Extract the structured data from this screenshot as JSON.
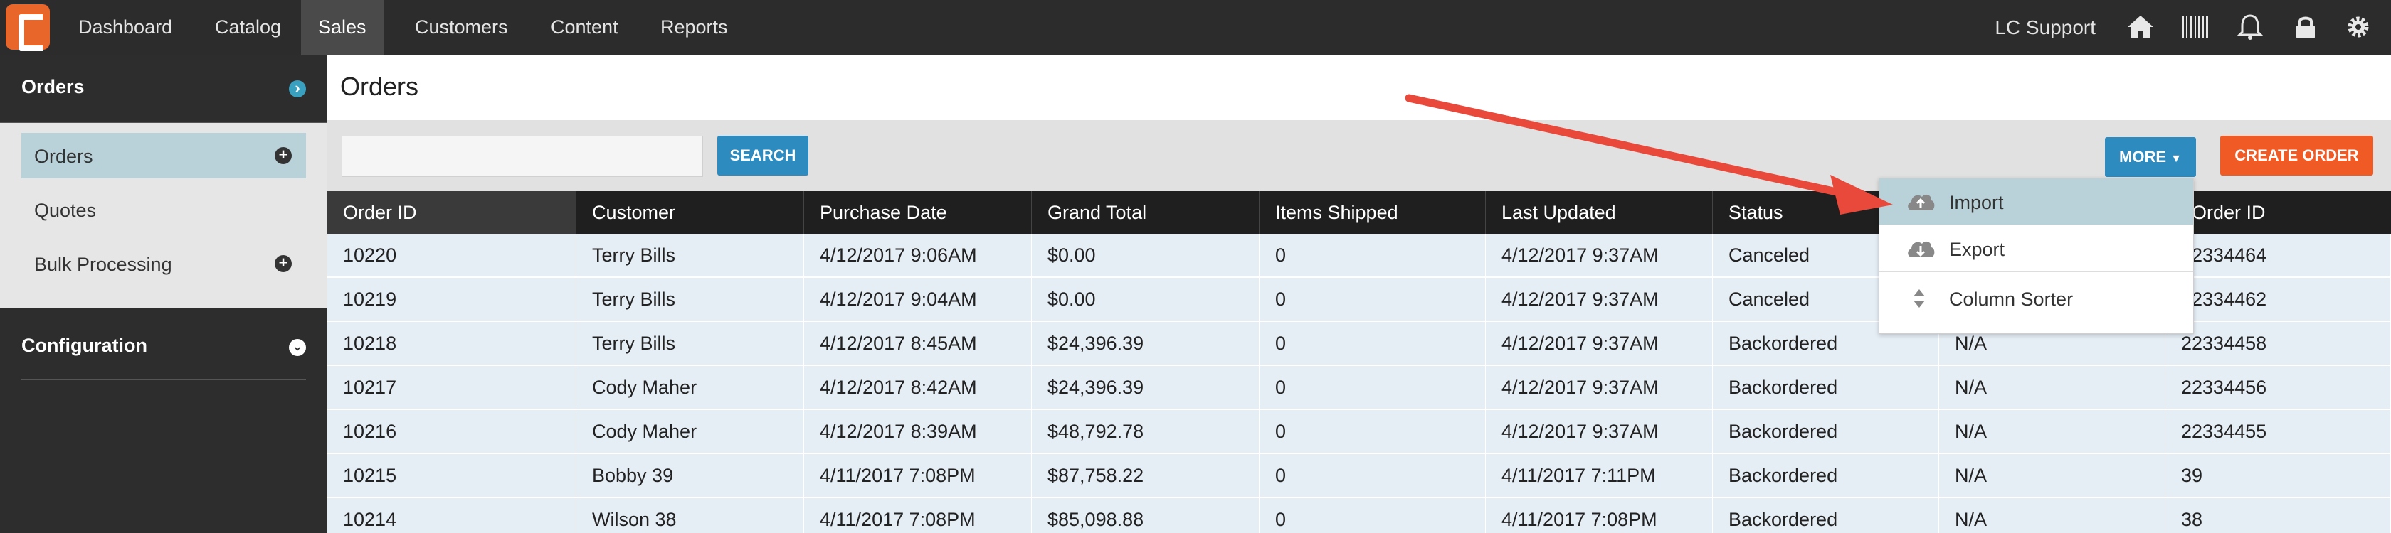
{
  "nav": {
    "items": [
      {
        "label": "Dashboard"
      },
      {
        "label": "Catalog"
      },
      {
        "label": "Sales"
      },
      {
        "label": "Customers"
      },
      {
        "label": "Content"
      },
      {
        "label": "Reports"
      }
    ],
    "active": "Sales",
    "support_label": "LC Support",
    "icons": [
      "home-icon",
      "barcode-icon",
      "bell-icon",
      "lock-icon",
      "gear-icon"
    ]
  },
  "sidebar": {
    "orders_header": "Orders",
    "items": [
      {
        "label": "Orders"
      },
      {
        "label": "Quotes"
      },
      {
        "label": "Bulk Processing"
      }
    ],
    "configuration_header": "Configuration"
  },
  "page": {
    "title": "Orders"
  },
  "toolbar": {
    "search_value": "",
    "search_label": "SEARCH",
    "more_label": "MORE",
    "create_label": "CREATE ORDER"
  },
  "table": {
    "columns": [
      "Order ID",
      "Customer",
      "Purchase Date",
      "Grand Total",
      "Items Shipped",
      "Last Updated",
      "Status",
      "",
      "t Order ID"
    ],
    "rows": [
      [
        "10220",
        "Terry Bills",
        "4/12/2017 9:06AM",
        "$0.00",
        "0",
        "4/12/2017 9:37AM",
        "Canceled",
        "",
        "22334464"
      ],
      [
        "10219",
        "Terry Bills",
        "4/12/2017 9:04AM",
        "$0.00",
        "0",
        "4/12/2017 9:37AM",
        "Canceled",
        "",
        "22334462"
      ],
      [
        "10218",
        "Terry Bills",
        "4/12/2017 8:45AM",
        "$24,396.39",
        "0",
        "4/12/2017 9:37AM",
        "Backordered",
        "N/A",
        "22334458"
      ],
      [
        "10217",
        "Cody Maher",
        "4/12/2017 8:42AM",
        "$24,396.39",
        "0",
        "4/12/2017 9:37AM",
        "Backordered",
        "N/A",
        "22334456"
      ],
      [
        "10216",
        "Cody Maher",
        "4/12/2017 8:39AM",
        "$48,792.78",
        "0",
        "4/12/2017 9:37AM",
        "Backordered",
        "N/A",
        "22334455"
      ],
      [
        "10215",
        "Bobby 39",
        "4/11/2017 7:08PM",
        "$87,758.22",
        "0",
        "4/11/2017 7:11PM",
        "Backordered",
        "N/A",
        "39"
      ],
      [
        "10214",
        "Wilson 38",
        "4/11/2017 7:08PM",
        "$85,098.88",
        "0",
        "4/11/2017 7:08PM",
        "Backordered",
        "N/A",
        "38"
      ]
    ]
  },
  "more_menu": {
    "items": [
      {
        "label": "Import",
        "icon": "cloud-upload-icon"
      },
      {
        "label": "Export",
        "icon": "cloud-download-icon"
      },
      {
        "label": "Column Sorter",
        "icon": "sort-icon"
      }
    ]
  },
  "colors": {
    "accent_blue": "#2d8bc0",
    "accent_orange": "#f05a24",
    "annotation_arrow": "#e8493a",
    "row_bg": "#e5edf5"
  }
}
